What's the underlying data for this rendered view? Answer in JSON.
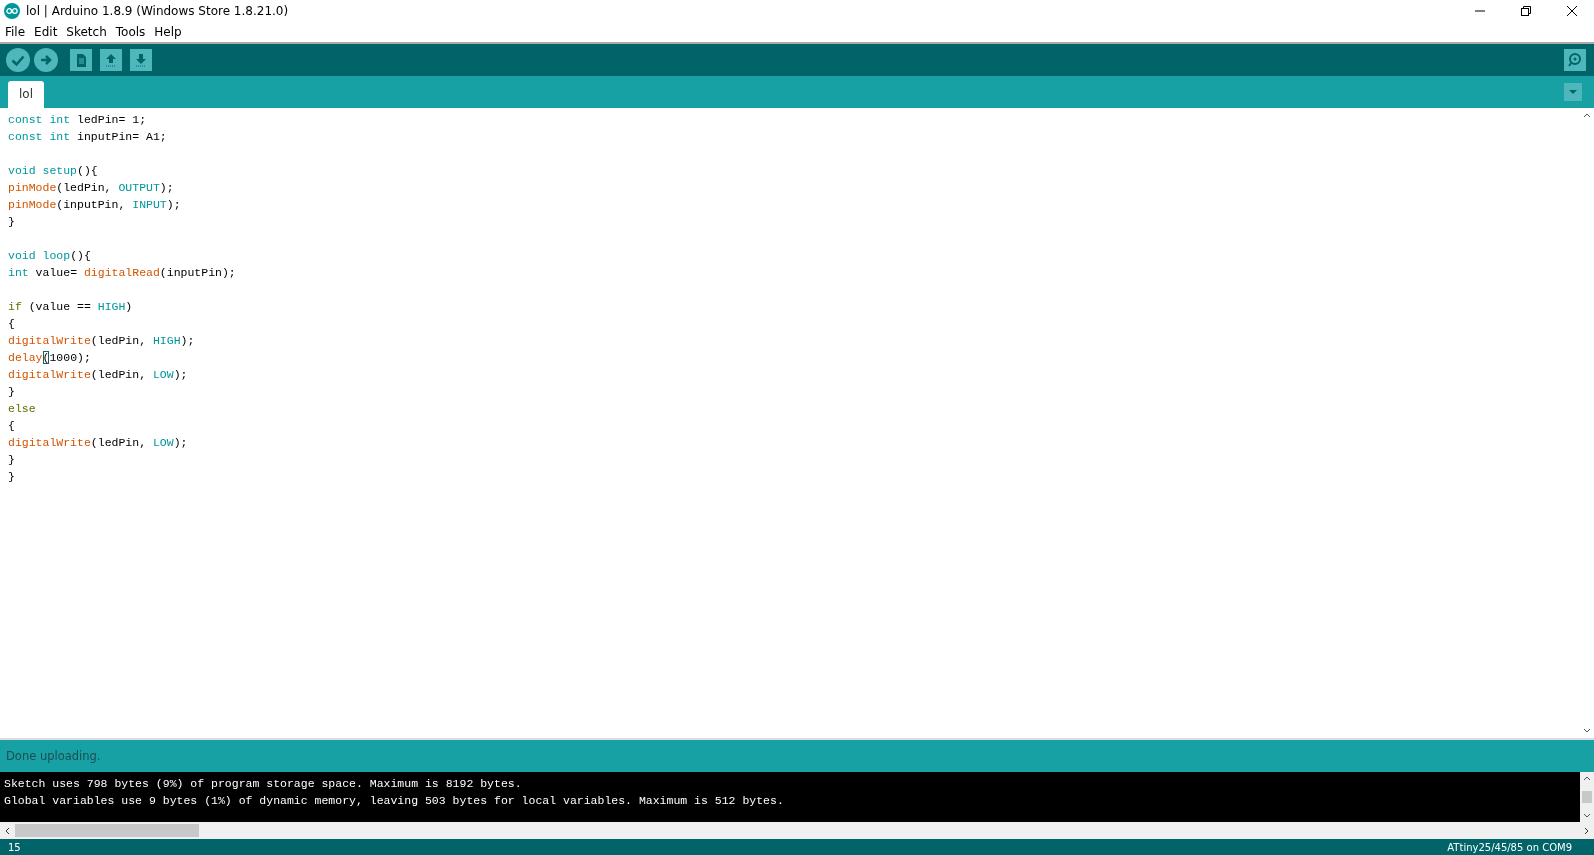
{
  "window": {
    "title": "lol | Arduino 1.8.9 (Windows Store 1.8.21.0)"
  },
  "menu": [
    "File",
    "Edit",
    "Sketch",
    "Tools",
    "Help"
  ],
  "tabs": [
    {
      "label": "lol",
      "selected": true
    }
  ],
  "editor": {
    "lines": [
      {
        "kind": "code",
        "tokens": [
          {
            "text": "const",
            "kind": "keyword"
          },
          {
            "text": " int",
            "kind": "keyword"
          },
          {
            "text": " ledPin= 1;"
          }
        ]
      },
      {
        "kind": "code",
        "tokens": [
          {
            "text": "const",
            "kind": "keyword"
          },
          {
            "text": " int",
            "kind": "keyword"
          },
          {
            "text": " inputPin= A1;"
          }
        ]
      },
      {
        "kind": "blank"
      },
      {
        "kind": "code",
        "tokens": [
          {
            "text": "void",
            "kind": "keyword"
          },
          {
            "text": " setup",
            "kind": "keyword"
          },
          {
            "text": "(){"
          }
        ]
      },
      {
        "kind": "code",
        "tokens": [
          {
            "text": "pinMode",
            "kind": "function"
          },
          {
            "text": "(ledPin, "
          },
          {
            "text": "OUTPUT",
            "kind": "constant"
          },
          {
            "text": ");"
          }
        ]
      },
      {
        "kind": "code",
        "tokens": [
          {
            "text": "pinMode",
            "kind": "function"
          },
          {
            "text": "(inputPin, "
          },
          {
            "text": "INPUT",
            "kind": "constant"
          },
          {
            "text": ");"
          }
        ]
      },
      {
        "kind": "code",
        "tokens": [
          {
            "text": "}"
          }
        ]
      },
      {
        "kind": "blank"
      },
      {
        "kind": "code",
        "tokens": [
          {
            "text": "void",
            "kind": "keyword"
          },
          {
            "text": " loop",
            "kind": "keyword"
          },
          {
            "text": "(){"
          }
        ]
      },
      {
        "kind": "code",
        "tokens": [
          {
            "text": "int",
            "kind": "keyword"
          },
          {
            "text": " value= "
          },
          {
            "text": "digitalRead",
            "kind": "function"
          },
          {
            "text": "(inputPin);"
          }
        ]
      },
      {
        "kind": "blank"
      },
      {
        "kind": "code",
        "tokens": [
          {
            "text": "if",
            "kind": "structure"
          },
          {
            "text": " (value == "
          },
          {
            "text": "HIGH",
            "kind": "constant"
          },
          {
            "text": ")"
          }
        ]
      },
      {
        "kind": "code",
        "tokens": [
          {
            "text": "{"
          }
        ]
      },
      {
        "kind": "code",
        "tokens": [
          {
            "text": "digitalWrite",
            "kind": "function"
          },
          {
            "text": "(ledPin, "
          },
          {
            "text": "HIGH",
            "kind": "constant"
          },
          {
            "text": ");"
          }
        ]
      },
      {
        "kind": "code",
        "tokens": [
          {
            "text": "delay",
            "kind": "function"
          },
          {
            "text": "(",
            "kind": "matched_bracket"
          },
          {
            "text": "1000);"
          }
        ]
      },
      {
        "kind": "code",
        "tokens": [
          {
            "text": "digitalWrite",
            "kind": "function"
          },
          {
            "text": "(ledPin, "
          },
          {
            "text": "LOW",
            "kind": "constant"
          },
          {
            "text": ");"
          }
        ]
      },
      {
        "kind": "code",
        "tokens": [
          {
            "text": "}"
          }
        ]
      },
      {
        "kind": "code",
        "tokens": [
          {
            "text": "else",
            "kind": "structure"
          }
        ]
      },
      {
        "kind": "code",
        "tokens": [
          {
            "text": "{"
          }
        ]
      },
      {
        "kind": "code",
        "tokens": [
          {
            "text": "digitalWrite",
            "kind": "function"
          },
          {
            "text": "(ledPin, "
          },
          {
            "text": "LOW",
            "kind": "constant"
          },
          {
            "text": ");"
          }
        ]
      },
      {
        "kind": "code",
        "tokens": [
          {
            "text": "}"
          }
        ]
      },
      {
        "kind": "code",
        "tokens": [
          {
            "text": "}"
          }
        ]
      }
    ]
  },
  "message_bar": {
    "text": "Done uploading."
  },
  "console": {
    "lines": [
      "Sketch uses 798 bytes (9%) of program storage space. Maximum is 8192 bytes.",
      "Global variables use 9 bytes (1%) of dynamic memory, leaving 503 bytes for local variables. Maximum is 512 bytes."
    ]
  },
  "status_bar": {
    "line_number": "15",
    "board": "ATtiny25/45/85 on COM9"
  }
}
